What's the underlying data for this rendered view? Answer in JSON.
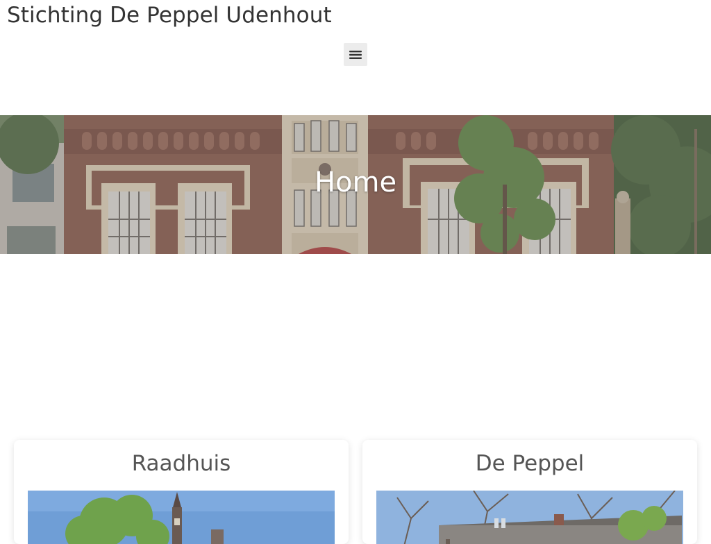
{
  "site": {
    "title": "Stichting De Peppel Udenhout"
  },
  "header": {
    "menu_icon": "hamburger-menu-icon"
  },
  "hero": {
    "title": "Home"
  },
  "cards": [
    {
      "title": "Raadhuis"
    },
    {
      "title": "De Peppel"
    }
  ],
  "colors": {
    "title_text": "#333333",
    "menu_button_bg": "#ececec",
    "card_title": "#555555",
    "hero_text": "#ffffff"
  }
}
